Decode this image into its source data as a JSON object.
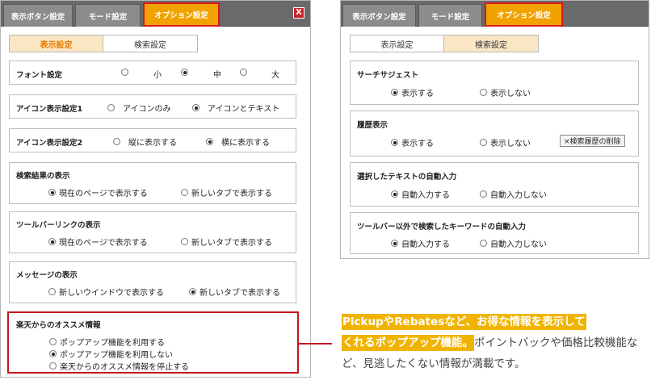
{
  "left_window": {
    "tabs": [
      {
        "label": "表示ボタン設定",
        "active": false
      },
      {
        "label": "モード設定",
        "active": false
      },
      {
        "label": "オプション設定",
        "active": true
      }
    ],
    "close_label": "X",
    "subtabs": [
      {
        "label": "表示設定",
        "active": true
      },
      {
        "label": "検索設定",
        "active": false
      }
    ],
    "font": {
      "title": "フォント設定",
      "options": [
        {
          "label": "小",
          "selected": false
        },
        {
          "label": "中",
          "selected": true
        },
        {
          "label": "大",
          "selected": false
        }
      ]
    },
    "icon1": {
      "title": "アイコン表示設定1",
      "options": [
        {
          "label": "アイコンのみ",
          "selected": false
        },
        {
          "label": "アイコンとテキスト",
          "selected": true
        }
      ]
    },
    "icon2": {
      "title": "アイコン表示設定2",
      "options": [
        {
          "label": "縦に表示する",
          "selected": false
        },
        {
          "label": "横に表示する",
          "selected": true
        }
      ]
    },
    "search_results": {
      "title": "検索結果の表示",
      "options": [
        {
          "label": "現在のページで表示する",
          "selected": true
        },
        {
          "label": "新しいタブで表示する",
          "selected": false
        }
      ]
    },
    "toolbar_link": {
      "title": "ツールバーリンクの表示",
      "options": [
        {
          "label": "現在のページで表示する",
          "selected": true
        },
        {
          "label": "新しいタブで表示する",
          "selected": false
        }
      ]
    },
    "message": {
      "title": "メッセージの表示",
      "options": [
        {
          "label": "新しいウインドウで表示する",
          "selected": false
        },
        {
          "label": "新しいタブで表示する",
          "selected": true
        }
      ]
    },
    "recommend": {
      "title": "楽天からのオススメ情報",
      "options": [
        {
          "label": "ポップアップ機能を利用する",
          "selected": false
        },
        {
          "label": "ポップアップ機能を利用しない",
          "selected": true
        },
        {
          "label": "楽天からのオススメ情報を停止する",
          "selected": false
        }
      ]
    }
  },
  "right_window": {
    "tabs": [
      {
        "label": "表示ボタン設定",
        "active": false
      },
      {
        "label": "モード設定",
        "active": false
      },
      {
        "label": "オプション設定",
        "active": true
      }
    ],
    "subtabs": [
      {
        "label": "表示設定",
        "active": false
      },
      {
        "label": "検索設定",
        "active": true
      }
    ],
    "suggest": {
      "title": "サーチサジェスト",
      "options": [
        {
          "label": "表示する",
          "selected": true
        },
        {
          "label": "表示しない",
          "selected": false
        }
      ]
    },
    "history": {
      "title": "履歴表示",
      "options": [
        {
          "label": "表示する",
          "selected": true
        },
        {
          "label": "表示しない",
          "selected": false
        }
      ],
      "delete_button": "×検索履歴の削除"
    },
    "selected_text": {
      "title": "選択したテキストの自動入力",
      "options": [
        {
          "label": "自動入力する",
          "selected": true
        },
        {
          "label": "自動入力しない",
          "selected": false
        }
      ]
    },
    "keyword": {
      "title": "ツールバー以外で検索したキーワードの自動入力",
      "options": [
        {
          "label": "自動入力する",
          "selected": true
        },
        {
          "label": "自動入力しない",
          "selected": false
        }
      ]
    }
  },
  "caption": {
    "highlight_1": "PickupやRebatesなど、お得な情報を表示して",
    "highlight_2": "くれるポップアップ機能。",
    "rest": "ポイントバックや価格比較機能など、見逃したくない情報が満載です。"
  },
  "colors": {
    "active_tab": "#f2a200",
    "highlight_border": "#c4161c",
    "caption_highlight": "#f0b400",
    "tabbar": "#6a6a6a"
  }
}
